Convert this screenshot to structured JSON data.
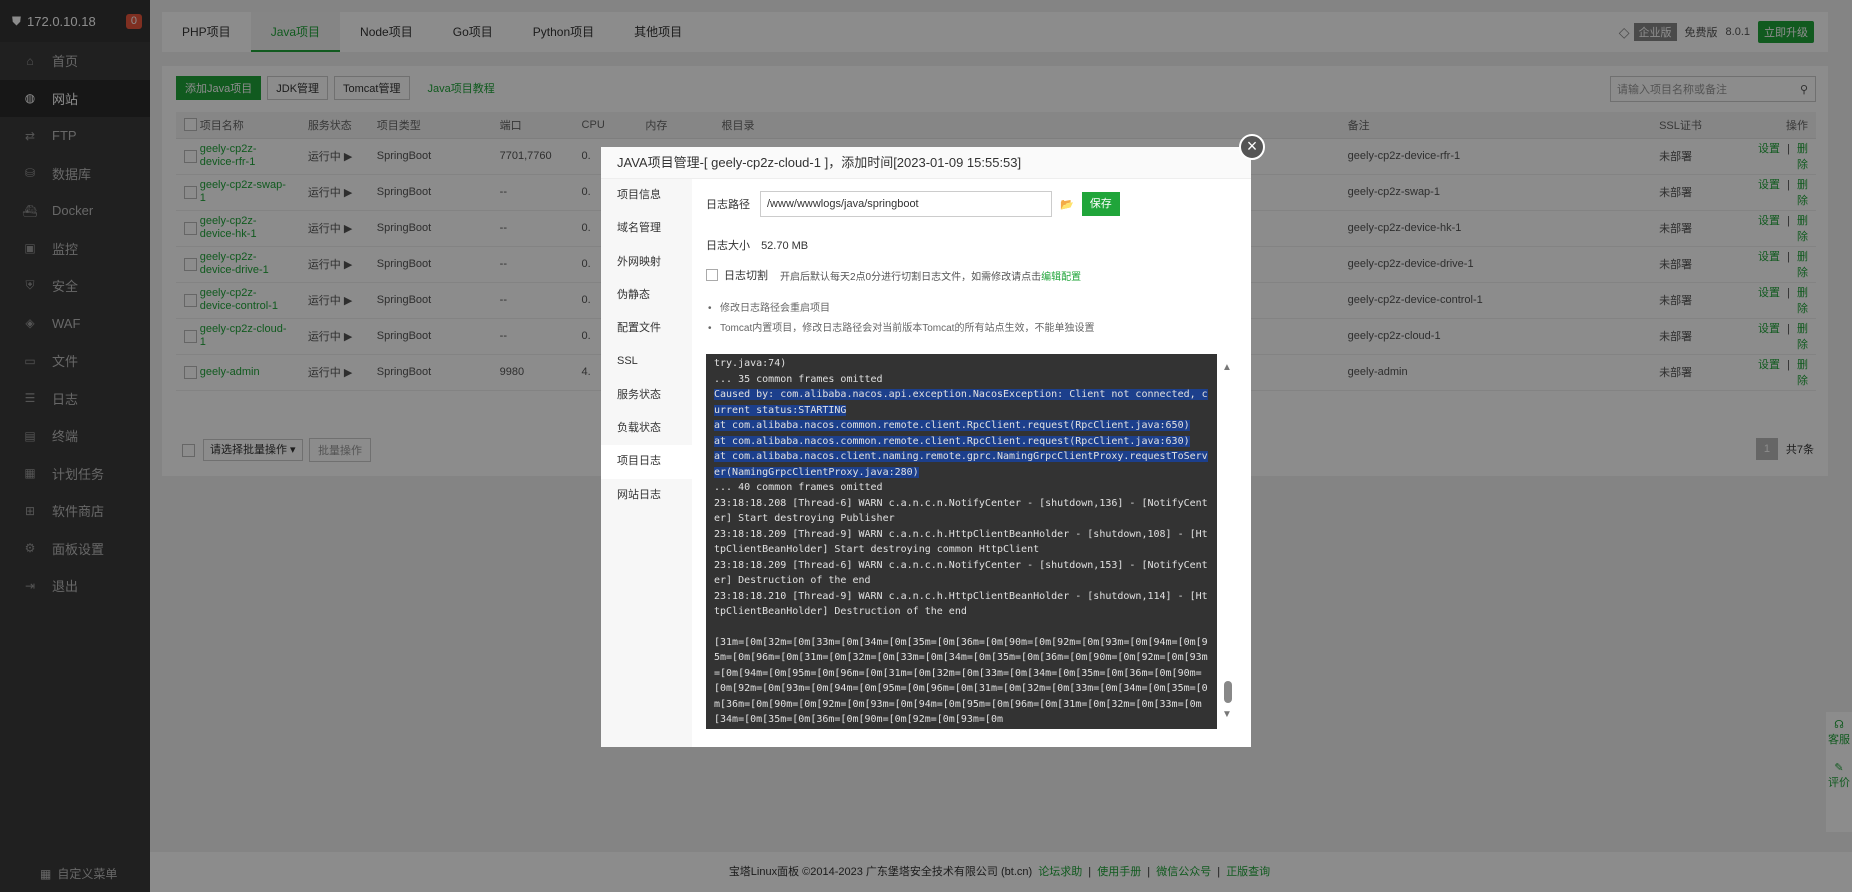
{
  "sidebar": {
    "host": "172.0.10.18",
    "count": "0",
    "items": [
      {
        "label": "首页",
        "icon": "home-icon"
      },
      {
        "label": "网站",
        "icon": "globe-icon"
      },
      {
        "label": "FTP",
        "icon": "ftp-icon"
      },
      {
        "label": "数据库",
        "icon": "database-icon"
      },
      {
        "label": "Docker",
        "icon": "docker-icon"
      },
      {
        "label": "监控",
        "icon": "monitor-icon"
      },
      {
        "label": "安全",
        "icon": "shield-icon"
      },
      {
        "label": "WAF",
        "icon": "waf-icon"
      },
      {
        "label": "文件",
        "icon": "folder-icon"
      },
      {
        "label": "日志",
        "icon": "log-icon"
      },
      {
        "label": "终端",
        "icon": "terminal-icon"
      },
      {
        "label": "计划任务",
        "icon": "calendar-icon"
      },
      {
        "label": "软件商店",
        "icon": "store-icon"
      },
      {
        "label": "面板设置",
        "icon": "gear-icon"
      },
      {
        "label": "退出",
        "icon": "logout-icon"
      }
    ],
    "custom_menu": "自定义菜单"
  },
  "topbar": {
    "tabs": [
      "PHP项目",
      "Java项目",
      "Node项目",
      "Go项目",
      "Python项目",
      "其他项目"
    ],
    "edition": "企业版",
    "free": "免费版",
    "version": "8.0.1",
    "upgrade": "立即升级"
  },
  "toolbar": {
    "add": "添加Java项目",
    "jdk": "JDK管理",
    "tomcat": "Tomcat管理",
    "tutorial": "Java项目教程",
    "search_placeholder": "请输入项目名称或备注"
  },
  "table": {
    "headers": [
      "项目名称",
      "服务状态",
      "项目类型",
      "端口",
      "CPU",
      "内存",
      "根目录",
      "备注",
      "SSL证书",
      "操作"
    ],
    "rows": [
      {
        "name": "geely-cp2z-device-rfr-1",
        "status": "运行中 ▶",
        "type": "SpringBoot",
        "port": "7701,7760",
        "cpu": "0.",
        "note": "geely-cp2z-device-rfr-1",
        "ssl": "未部署"
      },
      {
        "name": "geely-cp2z-swap-1",
        "status": "运行中 ▶",
        "type": "SpringBoot",
        "port": "--",
        "cpu": "0.",
        "note": "geely-cp2z-swap-1",
        "ssl": "未部署"
      },
      {
        "name": "geely-cp2z-device-hk-1",
        "status": "运行中 ▶",
        "type": "SpringBoot",
        "port": "--",
        "cpu": "0.",
        "note": "geely-cp2z-device-hk-1",
        "ssl": "未部署"
      },
      {
        "name": "geely-cp2z-device-drive-1",
        "status": "运行中 ▶",
        "type": "SpringBoot",
        "port": "--",
        "cpu": "0.",
        "note": "geely-cp2z-device-drive-1",
        "ssl": "未部署"
      },
      {
        "name": "geely-cp2z-device-control-1",
        "status": "运行中 ▶",
        "type": "SpringBoot",
        "port": "--",
        "cpu": "0.",
        "note": "geely-cp2z-device-control-1",
        "ssl": "未部署"
      },
      {
        "name": "geely-cp2z-cloud-1",
        "status": "运行中 ▶",
        "type": "SpringBoot",
        "port": "--",
        "cpu": "0.",
        "note": "geely-cp2z-cloud-1",
        "ssl": "未部署"
      },
      {
        "name": "geely-admin",
        "status": "运行中 ▶",
        "type": "SpringBoot",
        "port": "9980",
        "cpu": "4.",
        "note": "geely-admin",
        "ssl": "未部署"
      }
    ],
    "actions": {
      "settings": "设置",
      "sep": "|",
      "delete": "删除"
    },
    "batch_select": "请选择批量操作",
    "batch_button": "批量操作",
    "page": "1",
    "total": "共7条"
  },
  "footer": {
    "copyright": "宝塔Linux面板 ©2014-2023 广东堡塔安全技术有限公司 (bt.cn)",
    "links": [
      "论坛求助",
      "使用手册",
      "微信公众号",
      "正版查询"
    ]
  },
  "float": {
    "service": "客服",
    "review": "评价"
  },
  "modal": {
    "title": "JAVA项目管理-[ geely-cp2z-cloud-1 ]，添加时间[2023-01-09 15:55:53]",
    "menu": [
      "项目信息",
      "域名管理",
      "外网映射",
      "伪静态",
      "配置文件",
      "SSL",
      "服务状态",
      "负载状态",
      "项目日志",
      "网站日志"
    ],
    "log_path_label": "日志路径",
    "log_path_value": "/www/wwwlogs/java/springboot",
    "save": "保存",
    "log_size_label": "日志大小",
    "log_size_value": "52.70 MB",
    "log_cut_label": "日志切割",
    "log_cut_desc": "开启后默认每天2点0分进行切割日志文件，如需修改请点击",
    "log_cut_link": "编辑配置",
    "tips": [
      "修改日志路径会重启项目",
      "Tomcat内置项目，修改日志路径会对当前版本Tomcat的所有站点生效，不能单独设置"
    ],
    "log_lines": [
      {
        "text": "try.java:74)",
        "hl": false
      },
      {
        "text": "... 35 common frames omitted",
        "hl": false
      },
      {
        "text": "Caused by: com.alibaba.nacos.api.exception.NacosException: Client not connected, current status:STARTING",
        "hl": true
      },
      {
        "text": "at com.alibaba.nacos.common.remote.client.RpcClient.request(RpcClient.java:650)",
        "hl": true
      },
      {
        "text": "at com.alibaba.nacos.common.remote.client.RpcClient.request(RpcClient.java:630)",
        "hl": true
      },
      {
        "text": "at com.alibaba.nacos.client.naming.remote.gprc.NamingGrpcClientProxy.requestToServer(NamingGrpcClientProxy.java:280)",
        "hl": true
      },
      {
        "text": "... 40 common frames omitted",
        "hl": false
      },
      {
        "text": "23:18:18.208 [Thread-6] WARN c.a.n.c.n.NotifyCenter - [shutdown,136] - [NotifyCenter] Start destroying Publisher",
        "hl": false
      },
      {
        "text": "23:18:18.209 [Thread-9] WARN c.a.n.c.h.HttpClientBeanHolder - [shutdown,108] - [HttpClientBeanHolder] Start destroying common HttpClient",
        "hl": false
      },
      {
        "text": "23:18:18.209 [Thread-6] WARN c.a.n.c.n.NotifyCenter - [shutdown,153] - [NotifyCenter] Destruction of the end",
        "hl": false
      },
      {
        "text": "23:18:18.210 [Thread-9] WARN c.a.n.c.h.HttpClientBeanHolder - [shutdown,114] - [HttpClientBeanHolder] Destruction of the end",
        "hl": false
      },
      {
        "text": "",
        "hl": false
      },
      {
        "text": "[31m=[0m[32m=[0m[33m=[0m[34m=[0m[35m=[0m[36m=[0m[90m=[0m[92m=[0m[93m=[0m[94m=[0m[95m=[0m[96m=[0m[31m=[0m[32m=[0m[33m=[0m[34m=[0m[35m=[0m[36m=[0m[90m=[0m[92m=[0m[93m=[0m[94m=[0m[95m=[0m[96m=[0m[31m=[0m[32m=[0m[33m=[0m[34m=[0m[35m=[0m[36m=[0m[90m=[0m[92m=[0m[93m=[0m[94m=[0m[95m=[0m[96m=[0m[31m=[0m[32m=[0m[33m=[0m[34m=[0m[35m=[0m[36m=[0m[90m=[0m[92m=[0m[93m=[0m[94m=[0m[95m=[0m[96m=[0m[31m=[0m[32m=[0m[33m=[0m[34m=[0m[35m=[0m[36m=[0m[90m=[0m[92m=[0m[93m=[0m",
        "hl": false
      },
      {
        "text": "[34m= [92m=",
        "hl": false
      }
    ]
  }
}
